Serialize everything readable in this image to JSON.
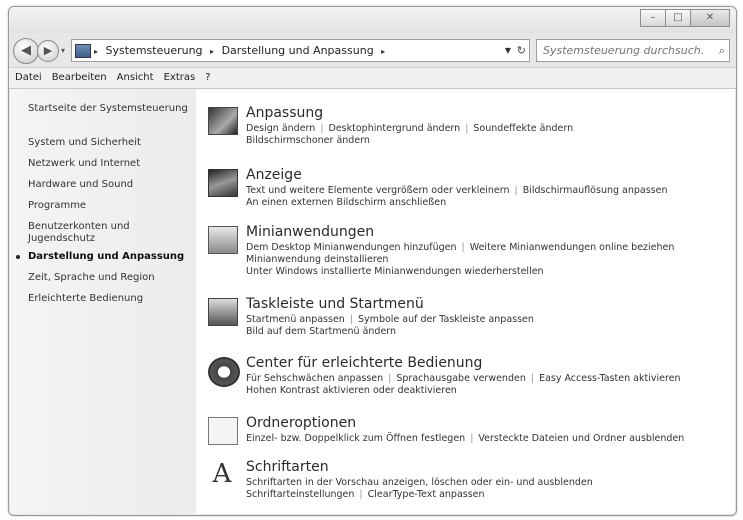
{
  "window": {
    "title_buttons": {
      "minimize": "–",
      "maximize": "□",
      "close": "✕"
    }
  },
  "nav": {
    "back_icon": "◀",
    "forward_icon": "▶",
    "address": {
      "crumbs": [
        "Systemsteuerung",
        "Darstellung und Anpassung"
      ],
      "separator": "▸"
    },
    "refresh_icon": "↻",
    "search_placeholder": "Systemsteuerung durchsuch...",
    "search_icon": "⌕"
  },
  "menu": [
    "Datei",
    "Bearbeiten",
    "Ansicht",
    "Extras",
    "?"
  ],
  "sidebar": {
    "home": "Startseite der Systemsteuerung",
    "items": [
      "System und Sicherheit",
      "Netzwerk und Internet",
      "Hardware und Sound",
      "Programme",
      "Benutzerkonten und Jugendschutz",
      "Darstellung und Anpassung",
      "Zeit, Sprache und Region",
      "Erleichterte Bedienung"
    ],
    "active_index": 5
  },
  "categories": [
    {
      "title": "Anpassung",
      "lines": [
        [
          "Design ändern",
          "Desktophintergrund ändern",
          "Soundeffekte ändern"
        ],
        [
          "Bildschirmschoner ändern"
        ]
      ]
    },
    {
      "title": "Anzeige",
      "lines": [
        [
          "Text und weitere Elemente vergrößern oder verkleinern",
          "Bildschirmauflösung anpassen"
        ],
        [
          "An einen externen Bildschirm anschließen"
        ]
      ]
    },
    {
      "title": "Minianwendungen",
      "lines": [
        [
          "Dem Desktop Minianwendungen hinzufügen",
          "Weitere Minianwendungen online beziehen"
        ],
        [
          "Minianwendung deinstallieren"
        ],
        [
          "Unter Windows installierte Minianwendungen wiederherstellen"
        ]
      ]
    },
    {
      "title": "Taskleiste und Startmenü",
      "lines": [
        [
          "Startmenü anpassen",
          "Symbole auf der Taskleiste anpassen"
        ],
        [
          "Bild auf dem Startmenü ändern"
        ]
      ]
    },
    {
      "title": "Center für erleichterte Bedienung",
      "lines": [
        [
          "Für Sehschwächen anpassen",
          "Sprachausgabe verwenden",
          "Easy Access-Tasten aktivieren"
        ],
        [
          "Hohen Kontrast aktivieren oder deaktivieren"
        ]
      ]
    },
    {
      "title": "Ordneroptionen",
      "lines": [
        [
          "Einzel- bzw. Doppelklick zum Öffnen festlegen",
          "Versteckte Dateien und Ordner ausblenden"
        ]
      ]
    },
    {
      "title": "Schriftarten",
      "lines": [
        [
          "Schriftarten in der Vorschau anzeigen, löschen oder ein- und ausblenden"
        ],
        [
          "Schriftarteinstellungen",
          "ClearType-Text anpassen"
        ]
      ]
    }
  ],
  "font_icon_glyph": "A"
}
